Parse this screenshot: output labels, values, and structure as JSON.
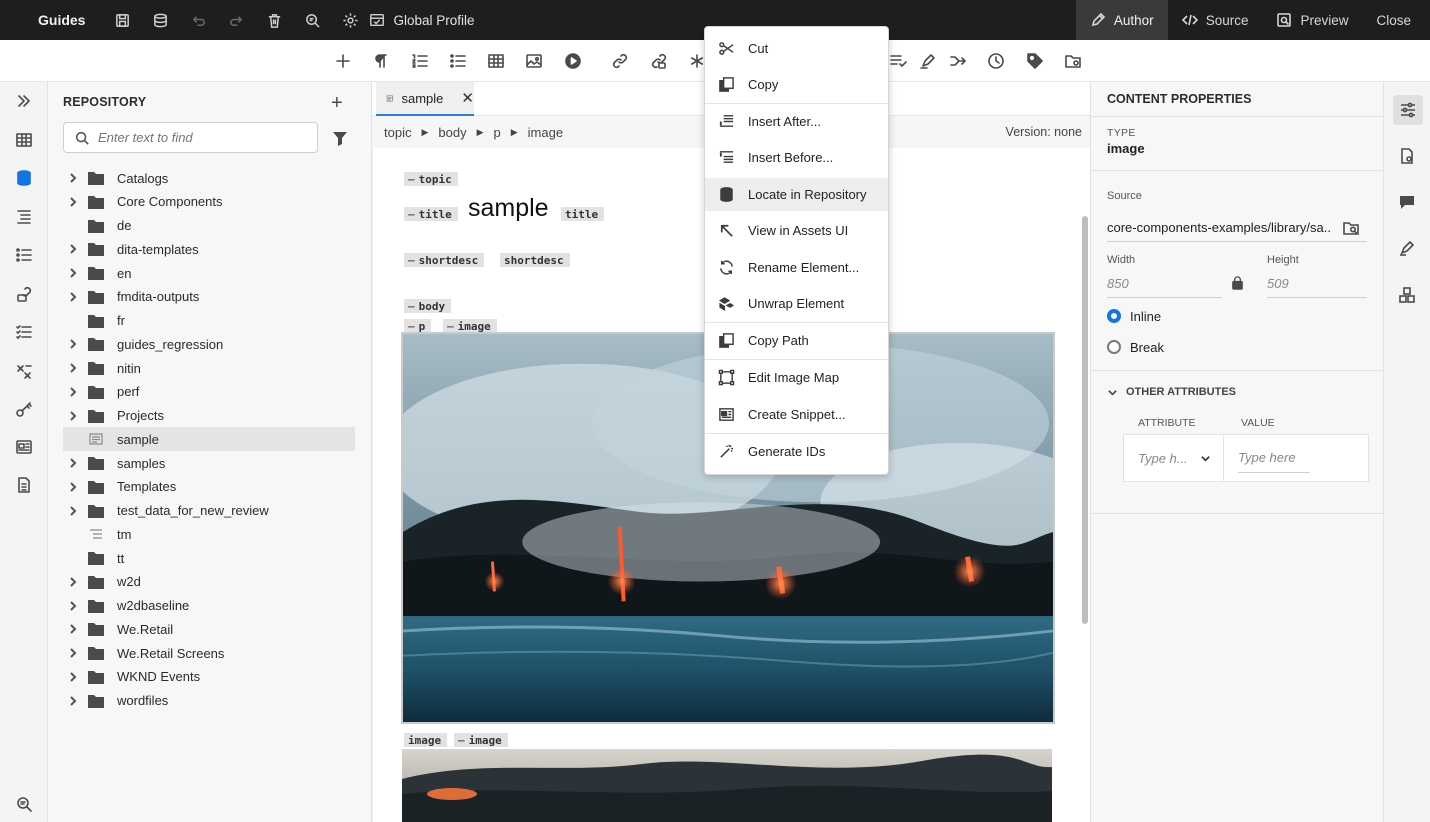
{
  "topbar": {
    "app_title": "Guides",
    "profile_label": "Global Profile",
    "modes": [
      {
        "label": "Author",
        "icon": "pencil-icon",
        "active": true
      },
      {
        "label": "Source",
        "icon": "code-icon",
        "active": false
      },
      {
        "label": "Preview",
        "icon": "preview-icon",
        "active": false
      },
      {
        "label": "Close",
        "icon": "",
        "active": false
      }
    ]
  },
  "repository": {
    "header": "REPOSITORY",
    "search_placeholder": "Enter text to find",
    "items": [
      {
        "label": "Catalogs",
        "type": "folder",
        "expandable": true
      },
      {
        "label": "Core Components",
        "type": "folder",
        "expandable": true
      },
      {
        "label": "de",
        "type": "folder",
        "expandable": false
      },
      {
        "label": "dita-templates",
        "type": "folder",
        "expandable": true
      },
      {
        "label": "en",
        "type": "folder",
        "expandable": true
      },
      {
        "label": "fmdita-outputs",
        "type": "folder",
        "expandable": true
      },
      {
        "label": "fr",
        "type": "folder",
        "expandable": false
      },
      {
        "label": "guides_regression",
        "type": "folder",
        "expandable": true
      },
      {
        "label": "nitin",
        "type": "folder",
        "expandable": true
      },
      {
        "label": "perf",
        "type": "folder",
        "expandable": true
      },
      {
        "label": "Projects",
        "type": "folder",
        "expandable": true
      },
      {
        "label": "sample",
        "type": "topic",
        "expandable": false,
        "selected": true
      },
      {
        "label": "samples",
        "type": "folder",
        "expandable": true
      },
      {
        "label": "Templates",
        "type": "folder",
        "expandable": true
      },
      {
        "label": "test_data_for_new_review",
        "type": "folder",
        "expandable": true
      },
      {
        "label": "tm",
        "type": "map",
        "expandable": false
      },
      {
        "label": "tt",
        "type": "folder",
        "expandable": false
      },
      {
        "label": "w2d",
        "type": "folder",
        "expandable": true
      },
      {
        "label": "w2dbaseline",
        "type": "folder",
        "expandable": true
      },
      {
        "label": "We.Retail",
        "type": "folder",
        "expandable": true
      },
      {
        "label": "We.Retail Screens",
        "type": "folder",
        "expandable": true
      },
      {
        "label": "WKND Events",
        "type": "folder",
        "expandable": true
      },
      {
        "label": "wordfiles",
        "type": "folder",
        "expandable": true
      }
    ]
  },
  "editor": {
    "tab_label": "sample",
    "breadcrumb": [
      "topic",
      "body",
      "p",
      "image"
    ],
    "version": "Version: none",
    "tags": {
      "topic": "topic",
      "title": "title",
      "title_text": "sample",
      "shortdesc": "shortdesc",
      "body": "body",
      "p": "p",
      "image": "image"
    }
  },
  "context_menu": {
    "items": [
      {
        "label": "Cut",
        "icon": "scissors-icon"
      },
      {
        "label": "Copy",
        "icon": "copy-icon"
      },
      {
        "label": "Insert After...",
        "icon": "insert-after-icon"
      },
      {
        "label": "Insert Before...",
        "icon": "insert-before-icon"
      },
      {
        "label": "Locate in Repository",
        "icon": "database-icon",
        "hover": true
      },
      {
        "label": "View in Assets UI",
        "icon": "arrow-up-left-icon"
      },
      {
        "label": "Rename Element...",
        "icon": "refresh-icon"
      },
      {
        "label": "Unwrap Element",
        "icon": "unwrap-icon"
      },
      {
        "label": "Copy Path",
        "icon": "copy-path-icon"
      },
      {
        "label": "Edit Image Map",
        "icon": "image-map-icon"
      },
      {
        "label": "Create Snippet...",
        "icon": "snippet-icon"
      },
      {
        "label": "Generate IDs",
        "icon": "magic-wand-icon"
      }
    ]
  },
  "properties": {
    "header": "CONTENT PROPERTIES",
    "type_label": "TYPE",
    "type_value": "image",
    "source_label": "Source",
    "source_value": "core-components-examples/library/sa...",
    "width_label": "Width",
    "width_value": "850",
    "height_label": "Height",
    "height_value": "509",
    "placement_options": [
      {
        "label": "Inline",
        "selected": true
      },
      {
        "label": "Break",
        "selected": false
      }
    ],
    "other_attributes_label": "OTHER ATTRIBUTES",
    "attribute_col": "ATTRIBUTE",
    "value_col": "VALUE",
    "attribute_placeholder": "Type h...",
    "value_placeholder": "Type here"
  },
  "colors": {
    "accent": "#1473e6",
    "topbar_bg": "#1e1e1e"
  }
}
